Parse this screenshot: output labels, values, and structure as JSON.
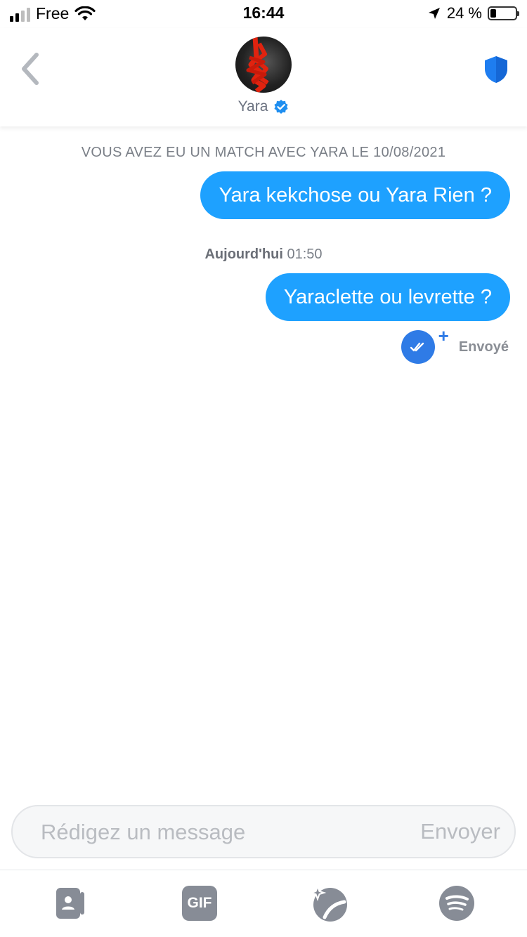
{
  "status_bar": {
    "carrier": "Free",
    "time": "16:44",
    "battery_pct_label": "24 %",
    "battery_level": 0.24
  },
  "header": {
    "name": "Yara",
    "back_icon": "chevron-left-icon",
    "safety_icon": "shield-icon"
  },
  "chat": {
    "match_notice": "VOUS AVEZ EU UN MATCH AVEC YARA LE 10/08/2021",
    "messages": [
      {
        "text": "Yara kekchose ou Yara Rien ?"
      },
      {
        "text": "Yaraclette ou levrette ?"
      }
    ],
    "timestamp_day": "Aujourd'hui",
    "timestamp_time": "01:50",
    "receipt_status": "Envoyé"
  },
  "composer": {
    "placeholder": "Rédigez un message",
    "send_label": "Envoyer"
  },
  "toolbar": {
    "gif_label": "GIF",
    "icons": [
      "contact-card-icon",
      "gif-icon",
      "sparkle-icon",
      "spotify-icon"
    ]
  },
  "colors": {
    "bubble": "#1ea1ff",
    "accent": "#2f7be6",
    "muted": "#7a7f87"
  }
}
